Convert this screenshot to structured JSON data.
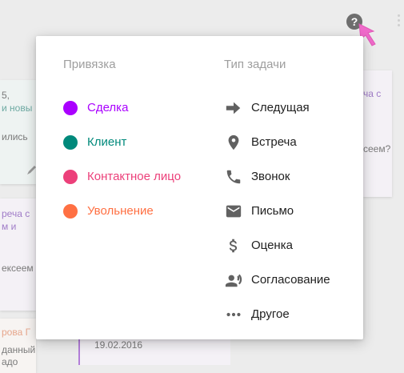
{
  "background": {
    "left_cards": [
      {
        "lines": [
          "5,",
          "и новы",
          "ились"
        ]
      },
      {
        "lines": [
          "реча с",
          "м и",
          "ексеем"
        ]
      },
      {
        "lines": [
          "рова Г",
          "данный",
          "адо"
        ]
      }
    ],
    "right_card": {
      "lines": [
        "ча с",
        "сеем?"
      ]
    },
    "middle_card": {
      "date": "19.02.2016"
    }
  },
  "header": {
    "help_button_label": "?"
  },
  "popup": {
    "binding": {
      "title": "Привязка",
      "items": [
        {
          "label": "Сделка",
          "color": "#aa00ff"
        },
        {
          "label": "Клиент",
          "color": "#00897b"
        },
        {
          "label": "Контактное лицо",
          "color": "#ec407a"
        },
        {
          "label": "Увольнение",
          "color": "#ff7043"
        }
      ]
    },
    "task_type": {
      "title": "Тип задачи",
      "items": [
        {
          "label": "Следущая",
          "icon": "arrow-right-icon"
        },
        {
          "label": "Встреча",
          "icon": "location-pin-icon"
        },
        {
          "label": "Звонок",
          "icon": "phone-icon"
        },
        {
          "label": "Письмо",
          "icon": "mail-icon"
        },
        {
          "label": "Оценка",
          "icon": "dollar-icon"
        },
        {
          "label": "Согласование",
          "icon": "voice-person-icon"
        },
        {
          "label": "Другое",
          "icon": "more-horizontal-icon"
        }
      ]
    }
  },
  "colors": {
    "icon": "#616161",
    "title": "#9e9e9e",
    "text": "#212121",
    "cursor": "#f06acb"
  }
}
